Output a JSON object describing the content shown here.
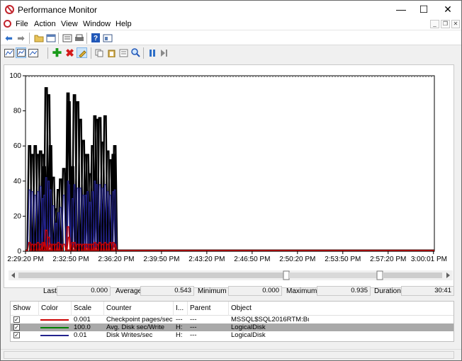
{
  "window": {
    "title": "Performance Monitor"
  },
  "window_controls": {
    "minimize": "—",
    "maximize": "☐",
    "close": "✕"
  },
  "menu": [
    "File",
    "Action",
    "View",
    "Window",
    "Help"
  ],
  "mdi_controls": {
    "minimize": "_",
    "restore": "❐",
    "close": "✕"
  },
  "toolbar_top": [
    "back-icon",
    "forward-icon",
    "open-folder-icon",
    "console-tree-icon",
    "show-hide-icon",
    "print-icon",
    "help-icon",
    "properties-icon"
  ],
  "toolbar_graph": [
    "view-current-activity-icon",
    "view-log-data-icon",
    "change-graph-type-icon",
    "add-counter-icon",
    "delete-counter-icon",
    "highlight-icon",
    "copy-properties-icon",
    "paste-counter-list-icon",
    "properties-icon",
    "zoom-icon",
    "freeze-display-icon",
    "update-data-icon"
  ],
  "colors": {
    "black_series": "#000000",
    "blue_series": "#23238e",
    "red_series": "#cc0000",
    "green_series": "#008000",
    "highlight_row": "#a9a9a9"
  },
  "chart_data": {
    "type": "line",
    "ylim": [
      0,
      100
    ],
    "yticks": [
      "0",
      "20",
      "40",
      "60",
      "80",
      "100"
    ],
    "xticks": [
      "2:29:20 PM",
      "2:32:50 PM",
      "2:36:20 PM",
      "2:39:50 PM",
      "2:43:20 PM",
      "2:46:50 PM",
      "2:50:20 PM",
      "2:53:50 PM",
      "2:57:20 PM",
      "3:00:01 PM"
    ],
    "grid": false,
    "peaks": [
      {
        "t": 0.09,
        "h": 60,
        "b": 35,
        "r": 5
      },
      {
        "t": 0.15,
        "h": 55,
        "b": 34,
        "r": 4
      },
      {
        "t": 0.215,
        "h": 60,
        "b": 32,
        "r": 4
      },
      {
        "t": 0.276,
        "h": 55,
        "b": 34,
        "r": 5
      },
      {
        "t": 0.332,
        "h": 57,
        "b": 37,
        "r": 4
      },
      {
        "t": 0.383,
        "h": 55,
        "b": 30,
        "r": 5
      },
      {
        "t": 0.415,
        "h": 48,
        "b": 32,
        "r": 5
      },
      {
        "t": 0.456,
        "h": 93,
        "b": 42,
        "r": 12
      },
      {
        "t": 0.51,
        "h": 89,
        "b": 40,
        "r": 8
      },
      {
        "t": 0.553,
        "h": 60,
        "b": 35,
        "r": 4
      },
      {
        "t": 0.612,
        "h": 42,
        "b": 26,
        "r": 4
      },
      {
        "t": 0.673,
        "h": 24,
        "b": 16,
        "r": 4
      },
      {
        "t": 0.724,
        "h": 35,
        "b": 22,
        "r": 5
      },
      {
        "t": 0.775,
        "h": 41,
        "b": 25,
        "r": 4
      },
      {
        "t": 0.845,
        "h": 47,
        "b": 32,
        "r": 4
      },
      {
        "t": 0.938,
        "h": 90,
        "b": 40,
        "r": 14
      },
      {
        "t": 0.96,
        "h": 85,
        "b": 38,
        "r": 8
      },
      {
        "t": 1.04,
        "h": 48,
        "b": 30,
        "r": 5
      },
      {
        "t": 1.08,
        "h": 89,
        "b": 38,
        "r": 5
      },
      {
        "t": 1.15,
        "h": 85,
        "b": 36,
        "r": 4
      },
      {
        "t": 1.21,
        "h": 75,
        "b": 36,
        "r": 4
      },
      {
        "t": 1.275,
        "h": 63,
        "b": 32,
        "r": 4
      },
      {
        "t": 1.326,
        "h": 55,
        "b": 32,
        "r": 4
      },
      {
        "t": 1.37,
        "h": 55,
        "b": 34,
        "r": 4
      },
      {
        "t": 1.425,
        "h": 44,
        "b": 28,
        "r": 4
      },
      {
        "t": 1.48,
        "h": 60,
        "b": 34,
        "r": 4
      },
      {
        "t": 1.53,
        "h": 77,
        "b": 40,
        "r": 5
      },
      {
        "t": 1.575,
        "h": 75,
        "b": 38,
        "r": 4
      },
      {
        "t": 1.64,
        "h": 76,
        "b": 38,
        "r": 5
      },
      {
        "t": 1.7,
        "h": 62,
        "b": 36,
        "r": 4
      },
      {
        "t": 1.756,
        "h": 77,
        "b": 38,
        "r": 5
      },
      {
        "t": 1.815,
        "h": 57,
        "b": 34,
        "r": 4
      },
      {
        "t": 1.869,
        "h": 52,
        "b": 32,
        "r": 5
      },
      {
        "t": 1.935,
        "h": 55,
        "b": 34,
        "r": 5
      },
      {
        "t": 1.97,
        "h": 60,
        "b": 35,
        "r": 4
      }
    ],
    "series": [
      {
        "name": "Checkpoint pages/sec",
        "color": "#cc0000"
      },
      {
        "name": "Avg. Disk sec/Write",
        "color": "#000000"
      },
      {
        "name": "Disk Writes/sec",
        "color": "#23238e"
      }
    ]
  },
  "stats": {
    "last_label": "Last",
    "last_value": "0.000",
    "average_label": "Average",
    "average_value": "0.543",
    "minimum_label": "Minimum",
    "minimum_value": "0.000",
    "maximum_label": "Maximum",
    "maximum_value": "0.935",
    "duration_label": "Duration",
    "duration_value": "30:41"
  },
  "table": {
    "headers": {
      "show": "Show",
      "color": "Color",
      "scale": "Scale",
      "counter": "Counter",
      "instance": "I...",
      "parent": "Parent",
      "object": "Object"
    },
    "rows": [
      {
        "show": "✓",
        "scale": "0.001",
        "counter": "Checkpoint pages/sec",
        "instance": "---",
        "parent": "---",
        "object": "MSSQL$SQL2016RTM:Bu..."
      },
      {
        "show": "✓",
        "scale": "100.0",
        "counter": "Avg. Disk sec/Write",
        "instance": "H:",
        "parent": "---",
        "object": "LogicalDisk"
      },
      {
        "show": "✓",
        "scale": "0.01",
        "counter": "Disk Writes/sec",
        "instance": "H:",
        "parent": "---",
        "object": "LogicalDisk"
      }
    ]
  }
}
